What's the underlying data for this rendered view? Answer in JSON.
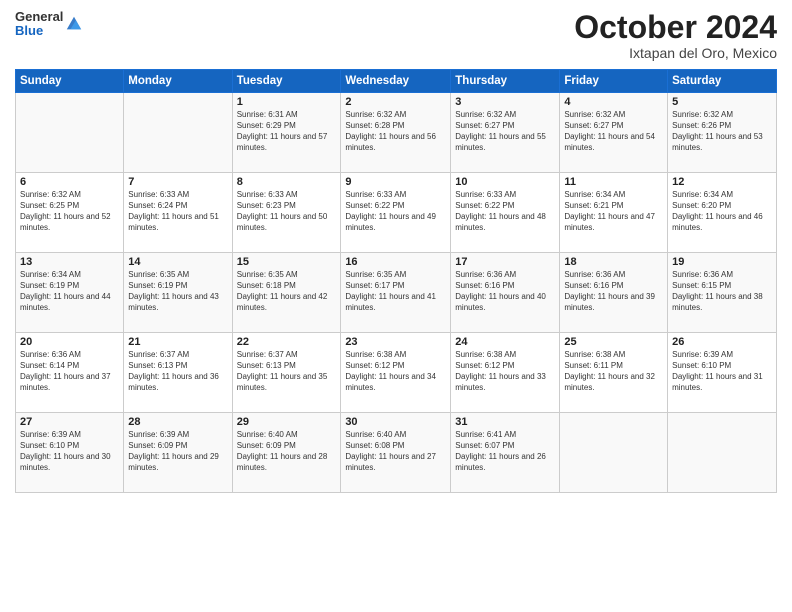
{
  "header": {
    "logo": {
      "line1": "General",
      "line2": "Blue"
    },
    "title": "October 2024",
    "subtitle": "Ixtapan del Oro, Mexico"
  },
  "days_of_week": [
    "Sunday",
    "Monday",
    "Tuesday",
    "Wednesday",
    "Thursday",
    "Friday",
    "Saturday"
  ],
  "weeks": [
    [
      {
        "day": "",
        "sunrise": "",
        "sunset": "",
        "daylight": ""
      },
      {
        "day": "",
        "sunrise": "",
        "sunset": "",
        "daylight": ""
      },
      {
        "day": "1",
        "sunrise": "Sunrise: 6:31 AM",
        "sunset": "Sunset: 6:29 PM",
        "daylight": "Daylight: 11 hours and 57 minutes."
      },
      {
        "day": "2",
        "sunrise": "Sunrise: 6:32 AM",
        "sunset": "Sunset: 6:28 PM",
        "daylight": "Daylight: 11 hours and 56 minutes."
      },
      {
        "day": "3",
        "sunrise": "Sunrise: 6:32 AM",
        "sunset": "Sunset: 6:27 PM",
        "daylight": "Daylight: 11 hours and 55 minutes."
      },
      {
        "day": "4",
        "sunrise": "Sunrise: 6:32 AM",
        "sunset": "Sunset: 6:27 PM",
        "daylight": "Daylight: 11 hours and 54 minutes."
      },
      {
        "day": "5",
        "sunrise": "Sunrise: 6:32 AM",
        "sunset": "Sunset: 6:26 PM",
        "daylight": "Daylight: 11 hours and 53 minutes."
      }
    ],
    [
      {
        "day": "6",
        "sunrise": "Sunrise: 6:32 AM",
        "sunset": "Sunset: 6:25 PM",
        "daylight": "Daylight: 11 hours and 52 minutes."
      },
      {
        "day": "7",
        "sunrise": "Sunrise: 6:33 AM",
        "sunset": "Sunset: 6:24 PM",
        "daylight": "Daylight: 11 hours and 51 minutes."
      },
      {
        "day": "8",
        "sunrise": "Sunrise: 6:33 AM",
        "sunset": "Sunset: 6:23 PM",
        "daylight": "Daylight: 11 hours and 50 minutes."
      },
      {
        "day": "9",
        "sunrise": "Sunrise: 6:33 AM",
        "sunset": "Sunset: 6:22 PM",
        "daylight": "Daylight: 11 hours and 49 minutes."
      },
      {
        "day": "10",
        "sunrise": "Sunrise: 6:33 AM",
        "sunset": "Sunset: 6:22 PM",
        "daylight": "Daylight: 11 hours and 48 minutes."
      },
      {
        "day": "11",
        "sunrise": "Sunrise: 6:34 AM",
        "sunset": "Sunset: 6:21 PM",
        "daylight": "Daylight: 11 hours and 47 minutes."
      },
      {
        "day": "12",
        "sunrise": "Sunrise: 6:34 AM",
        "sunset": "Sunset: 6:20 PM",
        "daylight": "Daylight: 11 hours and 46 minutes."
      }
    ],
    [
      {
        "day": "13",
        "sunrise": "Sunrise: 6:34 AM",
        "sunset": "Sunset: 6:19 PM",
        "daylight": "Daylight: 11 hours and 44 minutes."
      },
      {
        "day": "14",
        "sunrise": "Sunrise: 6:35 AM",
        "sunset": "Sunset: 6:19 PM",
        "daylight": "Daylight: 11 hours and 43 minutes."
      },
      {
        "day": "15",
        "sunrise": "Sunrise: 6:35 AM",
        "sunset": "Sunset: 6:18 PM",
        "daylight": "Daylight: 11 hours and 42 minutes."
      },
      {
        "day": "16",
        "sunrise": "Sunrise: 6:35 AM",
        "sunset": "Sunset: 6:17 PM",
        "daylight": "Daylight: 11 hours and 41 minutes."
      },
      {
        "day": "17",
        "sunrise": "Sunrise: 6:36 AM",
        "sunset": "Sunset: 6:16 PM",
        "daylight": "Daylight: 11 hours and 40 minutes."
      },
      {
        "day": "18",
        "sunrise": "Sunrise: 6:36 AM",
        "sunset": "Sunset: 6:16 PM",
        "daylight": "Daylight: 11 hours and 39 minutes."
      },
      {
        "day": "19",
        "sunrise": "Sunrise: 6:36 AM",
        "sunset": "Sunset: 6:15 PM",
        "daylight": "Daylight: 11 hours and 38 minutes."
      }
    ],
    [
      {
        "day": "20",
        "sunrise": "Sunrise: 6:36 AM",
        "sunset": "Sunset: 6:14 PM",
        "daylight": "Daylight: 11 hours and 37 minutes."
      },
      {
        "day": "21",
        "sunrise": "Sunrise: 6:37 AM",
        "sunset": "Sunset: 6:13 PM",
        "daylight": "Daylight: 11 hours and 36 minutes."
      },
      {
        "day": "22",
        "sunrise": "Sunrise: 6:37 AM",
        "sunset": "Sunset: 6:13 PM",
        "daylight": "Daylight: 11 hours and 35 minutes."
      },
      {
        "day": "23",
        "sunrise": "Sunrise: 6:38 AM",
        "sunset": "Sunset: 6:12 PM",
        "daylight": "Daylight: 11 hours and 34 minutes."
      },
      {
        "day": "24",
        "sunrise": "Sunrise: 6:38 AM",
        "sunset": "Sunset: 6:12 PM",
        "daylight": "Daylight: 11 hours and 33 minutes."
      },
      {
        "day": "25",
        "sunrise": "Sunrise: 6:38 AM",
        "sunset": "Sunset: 6:11 PM",
        "daylight": "Daylight: 11 hours and 32 minutes."
      },
      {
        "day": "26",
        "sunrise": "Sunrise: 6:39 AM",
        "sunset": "Sunset: 6:10 PM",
        "daylight": "Daylight: 11 hours and 31 minutes."
      }
    ],
    [
      {
        "day": "27",
        "sunrise": "Sunrise: 6:39 AM",
        "sunset": "Sunset: 6:10 PM",
        "daylight": "Daylight: 11 hours and 30 minutes."
      },
      {
        "day": "28",
        "sunrise": "Sunrise: 6:39 AM",
        "sunset": "Sunset: 6:09 PM",
        "daylight": "Daylight: 11 hours and 29 minutes."
      },
      {
        "day": "29",
        "sunrise": "Sunrise: 6:40 AM",
        "sunset": "Sunset: 6:09 PM",
        "daylight": "Daylight: 11 hours and 28 minutes."
      },
      {
        "day": "30",
        "sunrise": "Sunrise: 6:40 AM",
        "sunset": "Sunset: 6:08 PM",
        "daylight": "Daylight: 11 hours and 27 minutes."
      },
      {
        "day": "31",
        "sunrise": "Sunrise: 6:41 AM",
        "sunset": "Sunset: 6:07 PM",
        "daylight": "Daylight: 11 hours and 26 minutes."
      },
      {
        "day": "",
        "sunrise": "",
        "sunset": "",
        "daylight": ""
      },
      {
        "day": "",
        "sunrise": "",
        "sunset": "",
        "daylight": ""
      }
    ]
  ]
}
